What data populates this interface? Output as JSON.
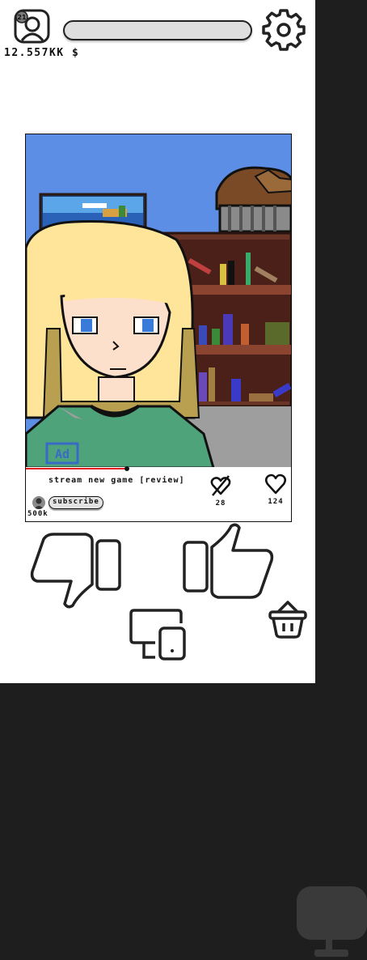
{
  "header": {
    "profile_badge": "21",
    "profile_icon": "user-profile-icon",
    "settings_icon": "gear-icon",
    "xp_progress": 0.0,
    "money": "12.557KK $"
  },
  "stream": {
    "title": "stream new game [review]",
    "ad_badge": "Ad",
    "video_progress": 0.38,
    "subscribe_label": "subscribe",
    "subscribers": "500k",
    "dislikes": "28",
    "likes": "124"
  },
  "controls": {
    "dislike_icon": "thumbs-down-icon",
    "like_icon": "thumbs-up-icon",
    "devices_icon": "devices-icon",
    "shop_icon": "basket-icon"
  },
  "colors": {
    "sky": "#5c8ee6",
    "shelf": "#6a3426",
    "hair": "#ffe59a",
    "shirt": "#4fa37a",
    "accent_red": "#e02020"
  }
}
